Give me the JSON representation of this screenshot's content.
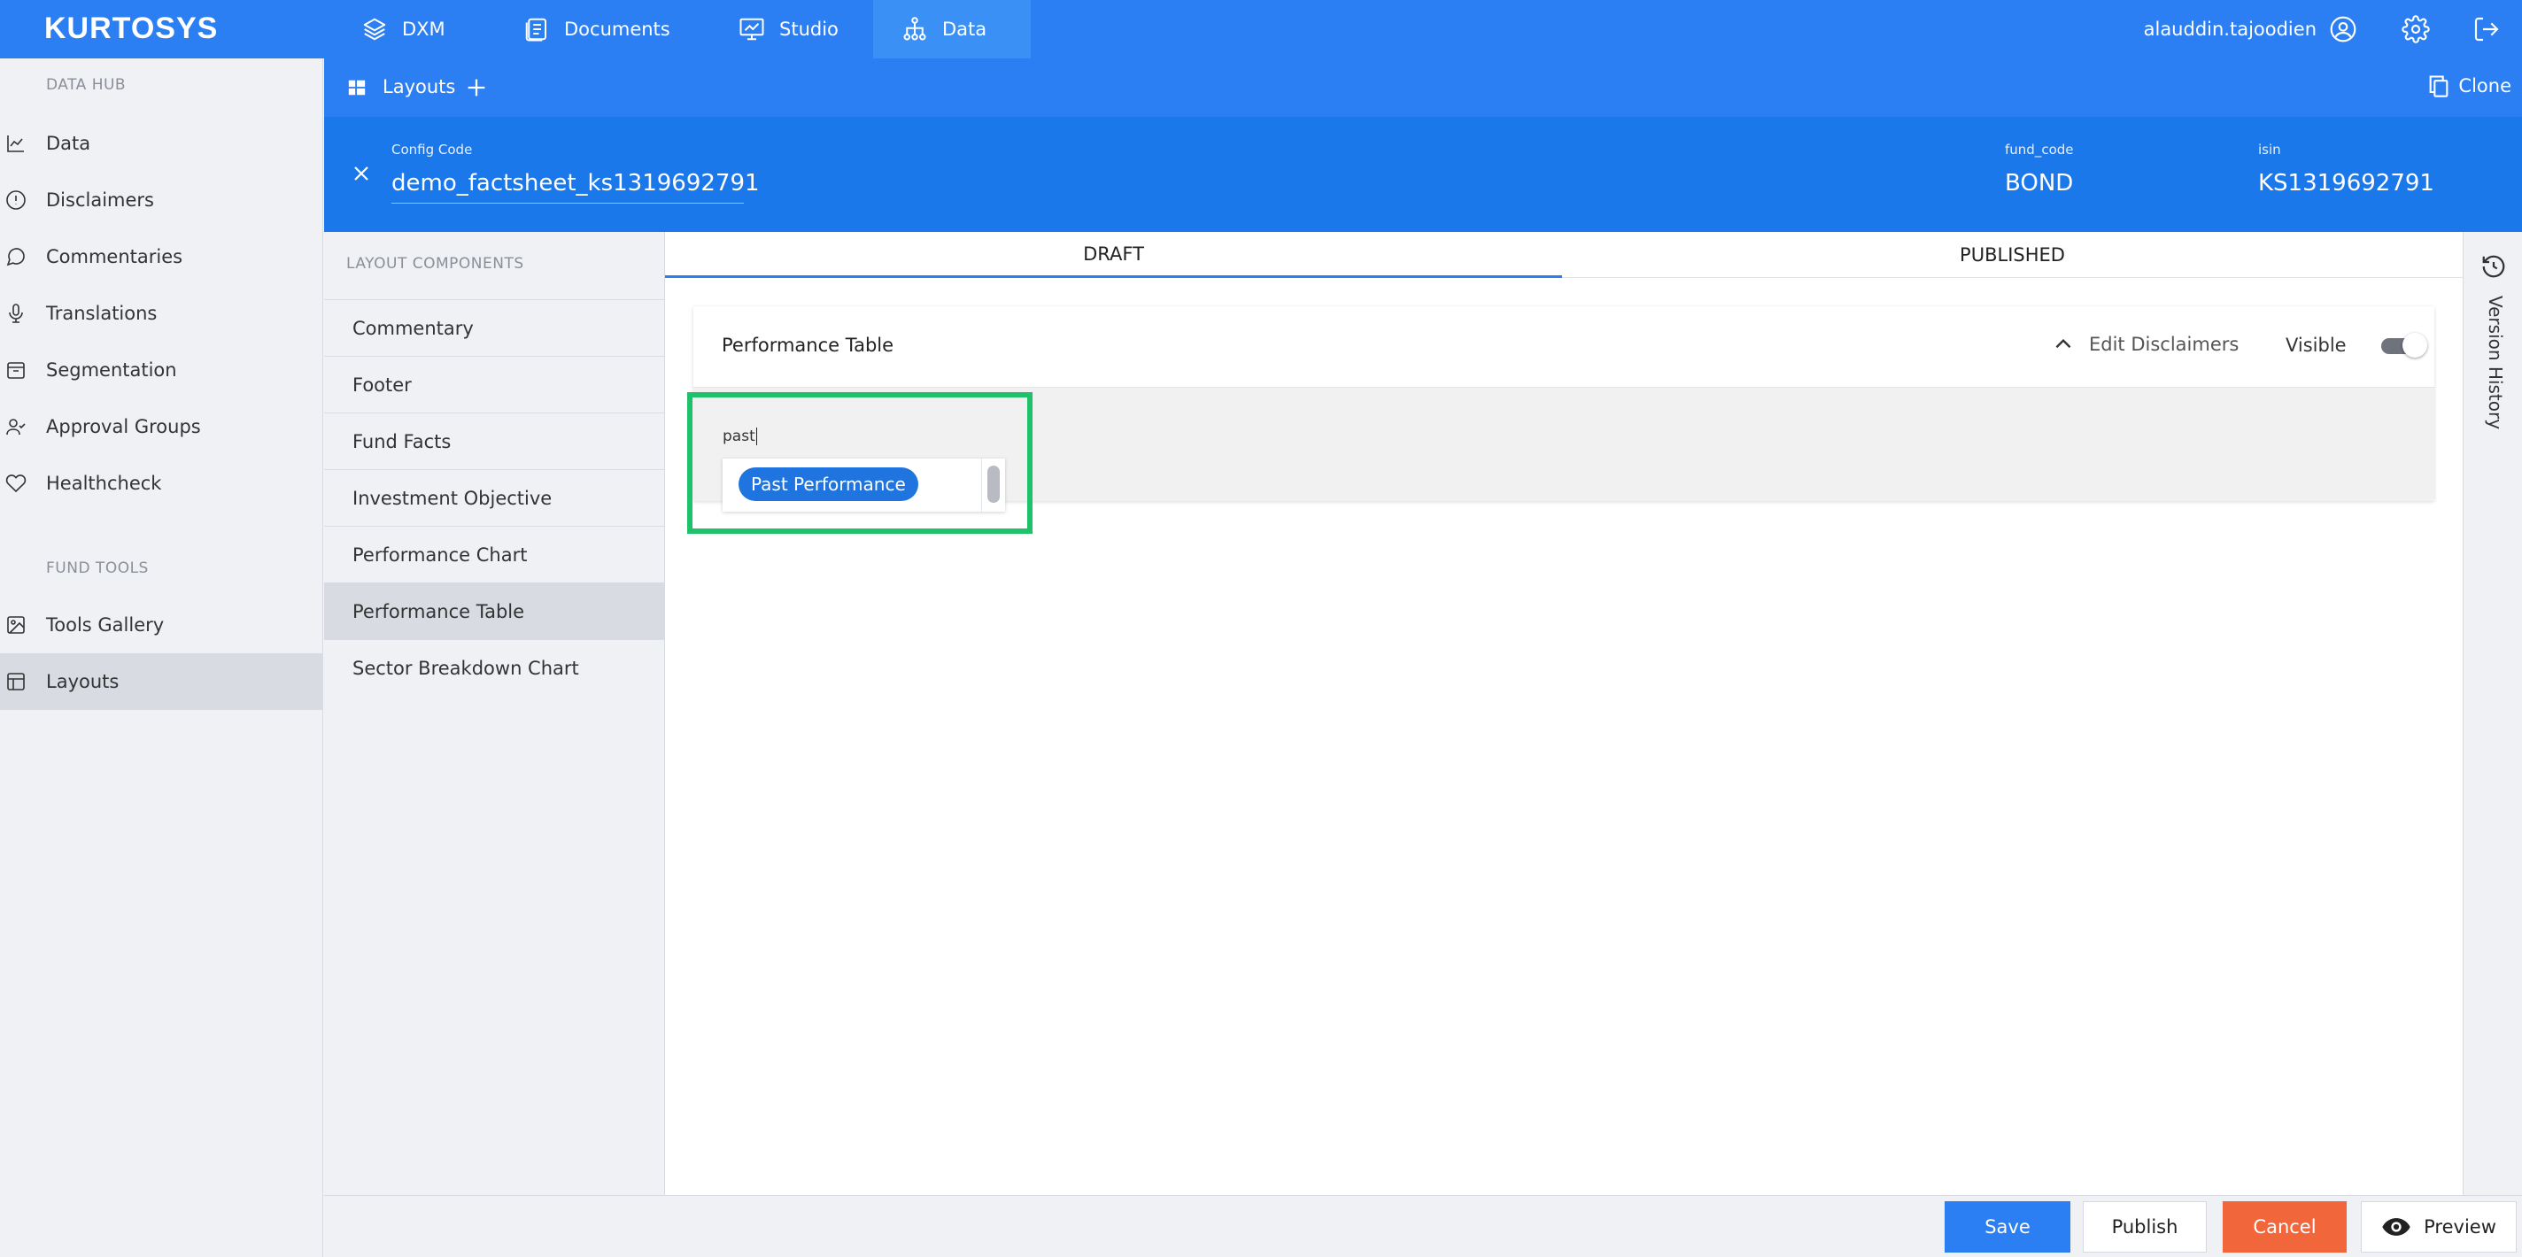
{
  "brand": {
    "logo_text": "KURTOSYS"
  },
  "topnav": {
    "tabs": [
      {
        "label": "DXM",
        "icon": "layers-icon"
      },
      {
        "label": "Documents",
        "icon": "documents-icon"
      },
      {
        "label": "Studio",
        "icon": "presentation-icon"
      },
      {
        "label": "Data",
        "icon": "hierarchy-icon",
        "active": true
      }
    ],
    "username": "alauddin.tajoodien"
  },
  "sidebar": {
    "data_hub_heading": "DATA HUB",
    "data_hub_items": [
      {
        "label": "Data",
        "icon": "line-chart-icon"
      },
      {
        "label": "Disclaimers",
        "icon": "alert-circle-icon"
      },
      {
        "label": "Commentaries",
        "icon": "comment-icon"
      },
      {
        "label": "Translations",
        "icon": "microphone-icon"
      },
      {
        "label": "Segmentation",
        "icon": "box-icon"
      },
      {
        "label": "Approval Groups",
        "icon": "user-check-icon"
      },
      {
        "label": "Healthcheck",
        "icon": "heart-icon"
      }
    ],
    "fund_tools_heading": "FUND TOOLS",
    "fund_tools_items": [
      {
        "label": "Tools Gallery",
        "icon": "image-icon"
      },
      {
        "label": "Layouts",
        "icon": "layout-icon",
        "active": true
      }
    ]
  },
  "subbar": {
    "title": "Layouts",
    "clone_label": "Clone"
  },
  "config": {
    "config_code_label": "Config Code",
    "config_code_value": "demo_factsheet_ks1319692791",
    "fund_code_label": "fund_code",
    "fund_code_value": "BOND",
    "isin_label": "isin",
    "isin_value": "KS1319692791"
  },
  "layout_components": {
    "heading": "LAYOUT COMPONENTS",
    "items": [
      "Commentary",
      "Footer",
      "Fund Facts",
      "Investment Objective",
      "Performance Chart",
      "Performance Table",
      "Sector Breakdown Chart"
    ],
    "active": "Performance Table"
  },
  "tabs": {
    "draft": "DRAFT",
    "published": "PUBLISHED",
    "active": "DRAFT"
  },
  "card": {
    "title": "Performance Table",
    "edit_disclaimers": "Edit Disclaimers",
    "visible_label": "Visible",
    "visible": true
  },
  "search": {
    "value": "past",
    "option_chip": "Past Performance"
  },
  "version_history": {
    "label": "Version History"
  },
  "actions": {
    "save": "Save",
    "publish": "Publish",
    "cancel": "Cancel",
    "preview": "Preview"
  },
  "colors": {
    "primary_blue": "#2c7ff2",
    "header_blue": "#1b78ea",
    "cancel_orange": "#f2663c",
    "highlight_green": "#1fc26b"
  }
}
